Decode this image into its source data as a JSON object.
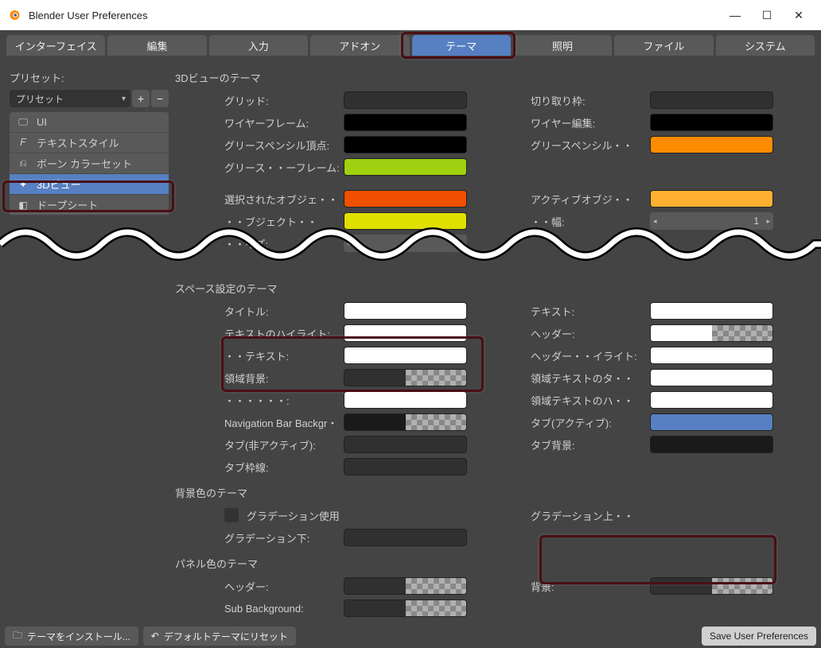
{
  "window": {
    "title": "Blender User Preferences"
  },
  "main_tabs": {
    "items": [
      "インターフェイス",
      "編集",
      "入力",
      "アドオン",
      "テーマ",
      "照明",
      "ファイル",
      "システム"
    ],
    "active_index": 4
  },
  "preset": {
    "label": "プリセット:",
    "value": "プリセット"
  },
  "categories": {
    "items": [
      {
        "icon": "monitor",
        "label": "UI"
      },
      {
        "icon": "font",
        "label": "テキストスタイル"
      },
      {
        "icon": "bone",
        "label": "ボーン カラーセット"
      },
      {
        "icon": "view3d",
        "label": "3Dビュー"
      },
      {
        "icon": "dopesheet",
        "label": "ドープシート"
      }
    ],
    "active_index": 3
  },
  "section1": {
    "title": "3Dビューのテーマ",
    "left": [
      {
        "label": "グリッド:",
        "color": "#303030"
      },
      {
        "label": "ワイヤーフレーム:",
        "color": "#000000"
      },
      {
        "label": "グリースペンシル頂点:",
        "color": "#000000"
      },
      {
        "label": "グリース・・ーフレーム:",
        "color": "#a0d010"
      }
    ],
    "right": [
      {
        "label": "切り取り枠:",
        "color": "#303030"
      },
      {
        "label": "ワイヤー編集:",
        "color": "#000000"
      },
      {
        "label": "グリースペンシル・・",
        "color": "#ff8c00"
      }
    ],
    "left2": [
      {
        "label": "選択されたオブジェ・・",
        "color": "#f05000"
      },
      {
        "label": "・・ブジェクト・・",
        "color": "#e0e000"
      },
      {
        "label": "・・イズ:",
        "value": "",
        "type": "num"
      }
    ],
    "right2": [
      {
        "label": "アクティブオブジ・・",
        "color": "#ffb030"
      },
      {
        "label": "・・幅:",
        "value": "1",
        "type": "num"
      }
    ]
  },
  "section2": {
    "title": "スペース設定のテーマ",
    "left": [
      {
        "label": "タイトル:",
        "color": "#ffffff"
      },
      {
        "label": "テキストのハイライト:",
        "color": "#ffffff"
      },
      {
        "label": "・・テキスト:",
        "color": "#ffffff"
      },
      {
        "label": "領域背景:",
        "split": [
          "#303030",
          "checker"
        ]
      },
      {
        "label": "・・・・・・:",
        "color": "#ffffff"
      },
      {
        "label": "Navigation Bar Backgr・・",
        "split": [
          "#1a1a1a",
          "checker"
        ]
      },
      {
        "label": "タブ(非アクティブ):",
        "color": "#303030"
      },
      {
        "label": "タブ枠線:",
        "color": "#303030"
      }
    ],
    "right": [
      {
        "label": "テキスト:",
        "color": "#ffffff"
      },
      {
        "label": "ヘッダー:",
        "split": [
          "#ffffff",
          "checker"
        ]
      },
      {
        "label": "ヘッダー・・イライト:",
        "color": "#ffffff"
      },
      {
        "label": "領域テキストのタ・・",
        "color": "#ffffff"
      },
      {
        "label": "領域テキストのハ・・",
        "color": "#ffffff"
      },
      {
        "label": "タブ(アクティブ):",
        "color": "#5680c2"
      },
      {
        "label": "タブ背景:",
        "color": "#1a1a1a"
      }
    ]
  },
  "section3": {
    "title": "背景色のテーマ",
    "left": [
      {
        "label": "グラデーション使用",
        "type": "checkbox"
      },
      {
        "label": "グラデーション下:",
        "color": "#303030"
      }
    ],
    "right": [
      {
        "label": "グラデーション上・・",
        "color": ""
      }
    ]
  },
  "section4": {
    "title": "パネル色のテーマ",
    "left": [
      {
        "label": "ヘッダー:",
        "split": [
          "#303030",
          "checker"
        ]
      },
      {
        "label": "Sub Background:",
        "split": [
          "#303030",
          "checker"
        ]
      }
    ],
    "right": [
      {
        "label": "背景:",
        "split": [
          "#303030",
          "checker"
        ]
      }
    ]
  },
  "bottom": {
    "install": "テーマをインストール...",
    "reset": "デフォルトテーマにリセット",
    "save": "Save User Preferences"
  }
}
